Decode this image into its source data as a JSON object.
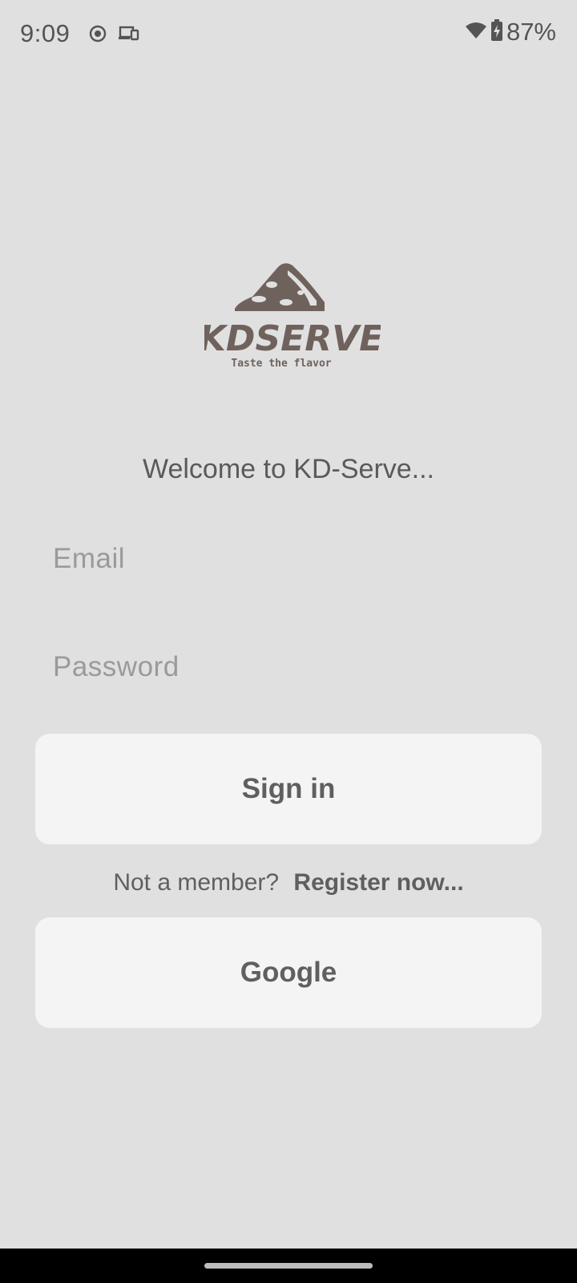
{
  "status_bar": {
    "time": "9:09",
    "battery": "87%",
    "icons": [
      "record-icon",
      "cast-icon",
      "wifi-icon",
      "battery-charging-icon"
    ]
  },
  "logo": {
    "brand": "KDSERVE",
    "tagline": "Taste the flavor",
    "color": "#6f625d"
  },
  "welcome_text": "Welcome to KD-Serve...",
  "form": {
    "email_placeholder": "Email",
    "password_placeholder": "Password"
  },
  "buttons": {
    "signin_label": "Sign in",
    "google_label": "Google"
  },
  "register": {
    "prompt": "Not a member?",
    "link_label": "Register now..."
  },
  "colors": {
    "background": "#e0e0e0",
    "button_bg": "#f4f4f4",
    "text": "#5f5f5f"
  }
}
